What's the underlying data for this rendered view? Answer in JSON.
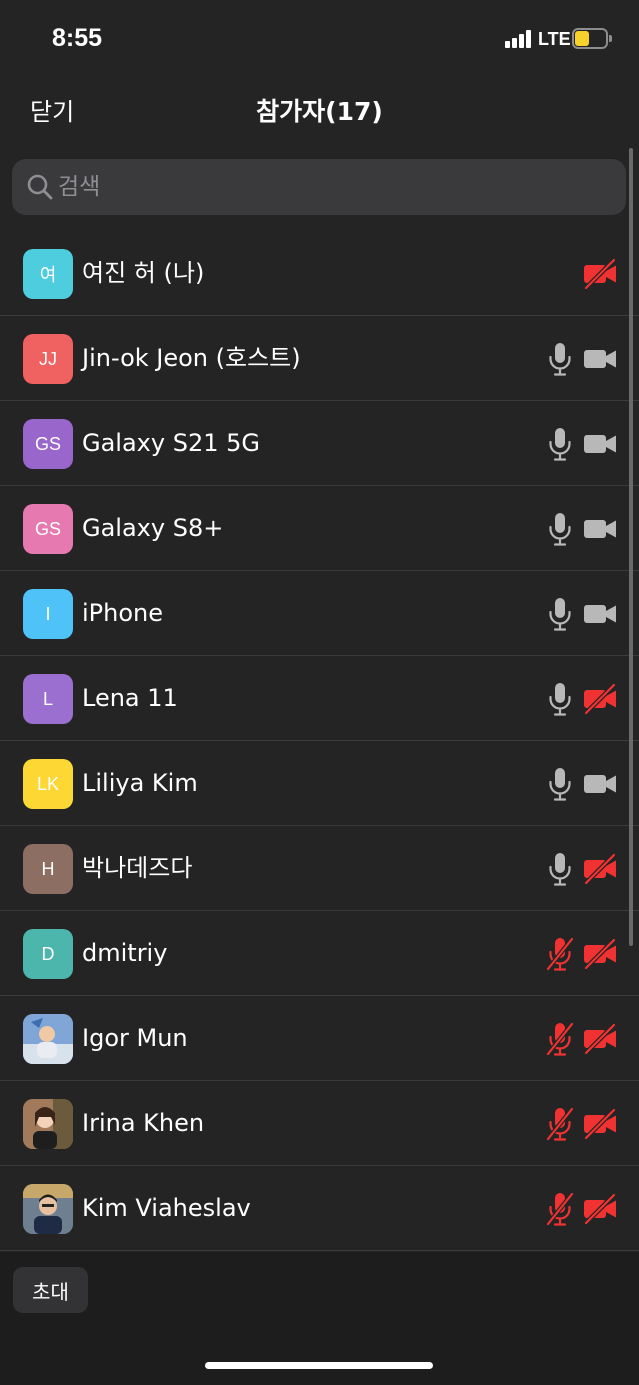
{
  "status": {
    "time": "8:55",
    "network": "LTE",
    "battery_fraction": 0.45
  },
  "nav": {
    "close_label": "닫기",
    "title": "참가자(17)"
  },
  "search": {
    "placeholder": "검색"
  },
  "participants": [
    {
      "initials": "여",
      "name": "여진 허 (나)",
      "avatar_color": "#4ecdde",
      "mic": "none",
      "video": "off"
    },
    {
      "initials": "JJ",
      "name": "Jin-ok Jeon (호스트)",
      "avatar_color": "#f06262",
      "mic": "on",
      "video": "on"
    },
    {
      "initials": "GS",
      "name": "Galaxy S21 5G",
      "avatar_color": "#9966cc",
      "mic": "on",
      "video": "on"
    },
    {
      "initials": "GS",
      "name": "Galaxy S8+",
      "avatar_color": "#e67ab0",
      "mic": "on",
      "video": "on"
    },
    {
      "initials": "I",
      "name": "iPhone",
      "avatar_color": "#4fc3f7",
      "mic": "on",
      "video": "on"
    },
    {
      "initials": "L",
      "name": "Lena 11",
      "avatar_color": "#9b6fd0",
      "mic": "on",
      "video": "off"
    },
    {
      "initials": "LK",
      "name": "Liliya Kim",
      "avatar_color": "#fdd835",
      "mic": "on",
      "video": "on"
    },
    {
      "initials": "H",
      "name": "박나데즈다",
      "avatar_color": "#8d6e63",
      "mic": "on",
      "video": "off"
    },
    {
      "initials": "D",
      "name": "dmitriy",
      "avatar_color": "#4db6ac",
      "mic": "off",
      "video": "off"
    },
    {
      "initials": "",
      "name": "Igor Mun",
      "avatar_color": "#7fa6d6",
      "mic": "off",
      "video": "off",
      "photo": "photo-igor"
    },
    {
      "initials": "",
      "name": "Irina Khen",
      "avatar_color": "#a07a5a",
      "mic": "off",
      "video": "off",
      "photo": "photo-irina"
    },
    {
      "initials": "",
      "name": "Kim Viaheslav",
      "avatar_color": "#6e7f8f",
      "mic": "off",
      "video": "off",
      "photo": "photo-kim"
    }
  ],
  "footer": {
    "invite_label": "초대"
  },
  "colors": {
    "background": "#242424",
    "muted_red": "#f03232",
    "icon_gray": "#b8b8b8"
  }
}
